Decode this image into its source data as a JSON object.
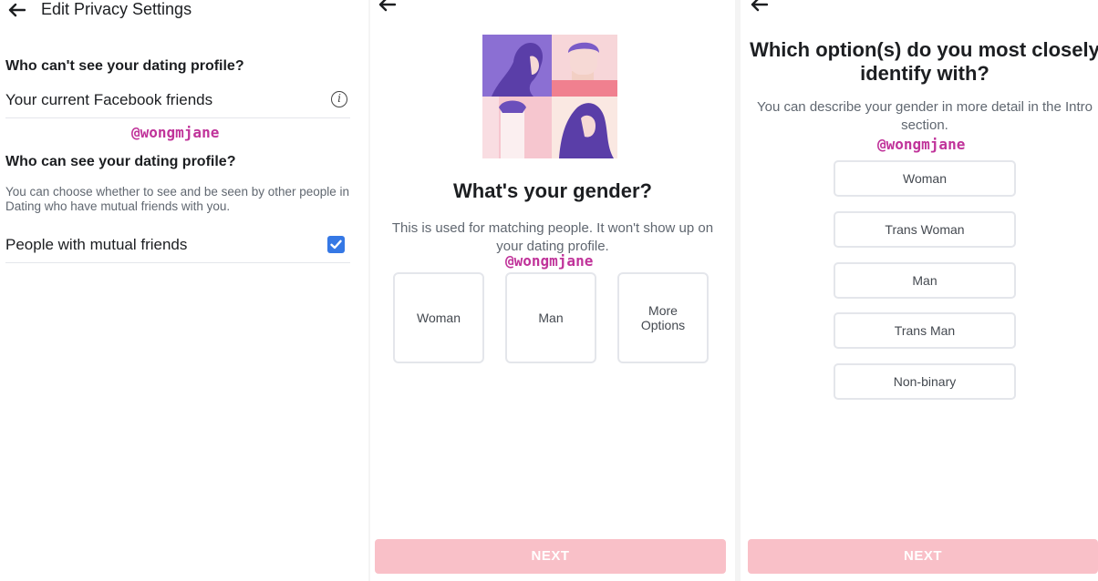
{
  "watermark": "@wongmjane",
  "colors": {
    "accent_blue": "#3578e5",
    "next_disabled": "#f9c0c8",
    "watermark": "#c0339a",
    "illus_purple": "#6b4fbb",
    "illus_pink": "#f4a7b9"
  },
  "panel1": {
    "back_icon": "back-arrow-icon",
    "title": "Edit Privacy Settings",
    "section1_heading": "Who can't see your dating profile?",
    "row1_label": "Your current Facebook friends",
    "info_glyph": "i",
    "section2_heading": "Who can see your dating profile?",
    "section2_description": "You can choose whether to see and be seen by other people in Dating who have mutual friends with you.",
    "row2_label": "People with mutual friends",
    "row2_checked": true
  },
  "panel2": {
    "back_icon": "back-arrow-icon",
    "title": "What's your gender?",
    "subtitle": "This is used for matching people. It won't show up on your dating profile.",
    "options": [
      "Woman",
      "Man",
      "More Options"
    ],
    "next_label": "NEXT"
  },
  "panel3": {
    "back_icon": "back-arrow-icon",
    "title": "Which option(s) do you most closely identify with?",
    "subtitle": "You can describe your gender in more detail in the Intro section.",
    "options": [
      "Woman",
      "Trans Woman",
      "Man",
      "Trans Man",
      "Non-binary"
    ],
    "next_label": "NEXT"
  }
}
